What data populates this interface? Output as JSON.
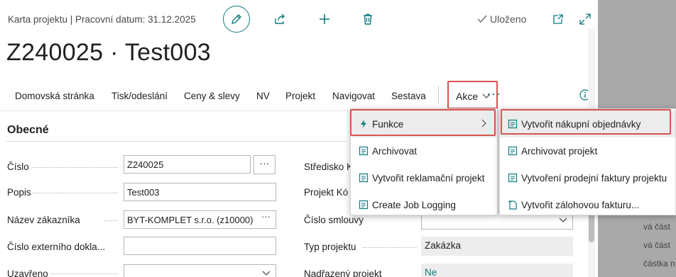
{
  "header": {
    "breadcrumb": "Karta projektu | Pracovní datum: 31.12.2025",
    "saved_label": "Uloženo"
  },
  "page_title": "Z240025 · Test003",
  "action_bar": {
    "items": [
      "Domovská stránka",
      "Tisk/odeslání",
      "Ceny & slevy",
      "NV",
      "Projekt",
      "Navigovat",
      "Sestava"
    ],
    "akce_label": "Akce",
    "more_label": "···"
  },
  "section": {
    "title": "Obecné"
  },
  "fields_left": [
    {
      "label": "Číslo",
      "value": "Z240025"
    },
    {
      "label": "Popis",
      "value": "Test003"
    },
    {
      "label": "Název zákazníka",
      "value": "BYT-KOMPLET s.r.o. (z10000)"
    },
    {
      "label": "Číslo externího dokla...",
      "value": ""
    },
    {
      "label": "Uzavřeno",
      "value": ""
    }
  ],
  "fields_right": [
    {
      "label": "Středisko K",
      "value": ""
    },
    {
      "label": "Projekt Kó",
      "value": ""
    },
    {
      "label": "Číslo smlouvy",
      "value": ""
    },
    {
      "label": "Typ projektu",
      "value": "Zakázka"
    },
    {
      "label": "Nadřazený projekt",
      "value": "Ne"
    }
  ],
  "akce_menu": {
    "items": [
      "Funkce",
      "Archivovat",
      "Vytvořit reklamační projekt",
      "Create Job Logging"
    ]
  },
  "funkce_submenu": {
    "items": [
      "Vytvořit nákupní objednávky",
      "Archivovat projekt",
      "Vytvoření prodejní faktury projektu",
      "Vytvořit zálohovou fakturu..."
    ]
  },
  "side_panel": {
    "texts": [
      "vá část",
      "vá část",
      "částka n"
    ]
  },
  "colors": {
    "accent": "#0f7a80",
    "highlight_border": "#d9534f"
  }
}
